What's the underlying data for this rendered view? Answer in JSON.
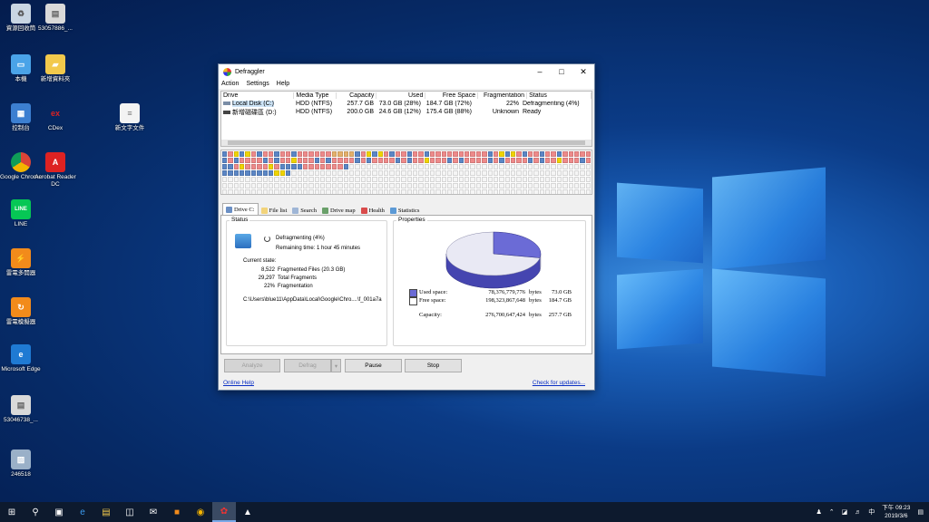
{
  "desktop": {
    "icons": [
      {
        "label": "資源回收筒",
        "icon": "recycle-bin-icon"
      },
      {
        "label": "53057886_...",
        "icon": "file-icon"
      },
      {
        "label": "本機",
        "icon": "computer-icon"
      },
      {
        "label": "新增資料夾",
        "icon": "folder-icon"
      },
      {
        "label": "控制台",
        "icon": "control-panel-icon"
      },
      {
        "label": "CDex",
        "icon": "cdex-icon"
      },
      {
        "label": "新文字文件",
        "icon": "text-file-icon"
      },
      {
        "label": "Google Chrome",
        "icon": "chrome-icon"
      },
      {
        "label": "Acrobat Reader DC",
        "icon": "acrobat-icon"
      },
      {
        "label": "LINE",
        "icon": "line-icon"
      },
      {
        "label": "雷電多開器",
        "icon": "ld-multi-icon"
      },
      {
        "label": "雷電模擬器",
        "icon": "ld-player-icon"
      },
      {
        "label": "Microsoft Edge",
        "icon": "edge-icon"
      },
      {
        "label": "53046738_...",
        "icon": "file-icon"
      },
      {
        "label": "246518",
        "icon": "image-icon"
      }
    ]
  },
  "window": {
    "title": "Defraggler",
    "menu": [
      "Action",
      "Settings",
      "Help"
    ],
    "drive_columns": [
      "Drive",
      "Media Type",
      "Capacity",
      "Used",
      "Free Space",
      "Fragmentation",
      "Status"
    ],
    "drives": [
      {
        "drive": "Local Disk (C:)",
        "media": "HDD (NTFS)",
        "capacity": "257.7 GB",
        "used": "73.0 GB (28%)",
        "free": "184.7 GB (72%)",
        "frag": "22%",
        "status": "Defragmenting (4%)"
      },
      {
        "drive": "新增磁碟區 (D:)",
        "media": "HDD (NTFS)",
        "capacity": "200.0 GB",
        "used": "24.6 GB (12%)",
        "free": "175.4 GB (88%)",
        "frag": "Unknown",
        "status": "Ready"
      }
    ],
    "tabs": [
      "Drive C:",
      "File list",
      "Search",
      "Drive map",
      "Health",
      "Statistics"
    ],
    "status": {
      "group_label": "Status",
      "state": "Defragmenting (4%)",
      "remaining": "Remaining time: 1 hour 45 minutes",
      "current_state_label": "Current state:",
      "rows": [
        {
          "value": "8,522",
          "label": "Fragmented Files (20.3 GB)"
        },
        {
          "value": "29,297",
          "label": "Total Fragments"
        },
        {
          "value": "22%",
          "label": "Fragmentation"
        }
      ],
      "path": "C:\\Users\\blue11\\AppData\\Local\\Google\\Chro....\\f_001a7a"
    },
    "properties": {
      "group_label": "Properties",
      "used_label": "Used space:",
      "used_bytes": "78,376,779,776",
      "used_gb": "73.0 GB",
      "free_label": "Free space:",
      "free_bytes": "198,323,867,648",
      "free_gb": "184.7 GB",
      "capacity_label": "Capacity:",
      "capacity_bytes": "276,700,647,424",
      "capacity_gb": "257.7 GB",
      "bytes_unit": "bytes",
      "used_fraction": 0.28,
      "used_color": "#6b6bd6",
      "free_color": "#e9e9f4"
    },
    "buttons": {
      "analyze": "Analyze",
      "defrag": "Defrag",
      "pause": "Pause",
      "stop": "Stop"
    },
    "links": {
      "help": "Online Help",
      "updates": "Check for updates..."
    }
  },
  "taskbar": {
    "time": "下午 09:23",
    "date": "2019/3/6",
    "ime": "中"
  }
}
